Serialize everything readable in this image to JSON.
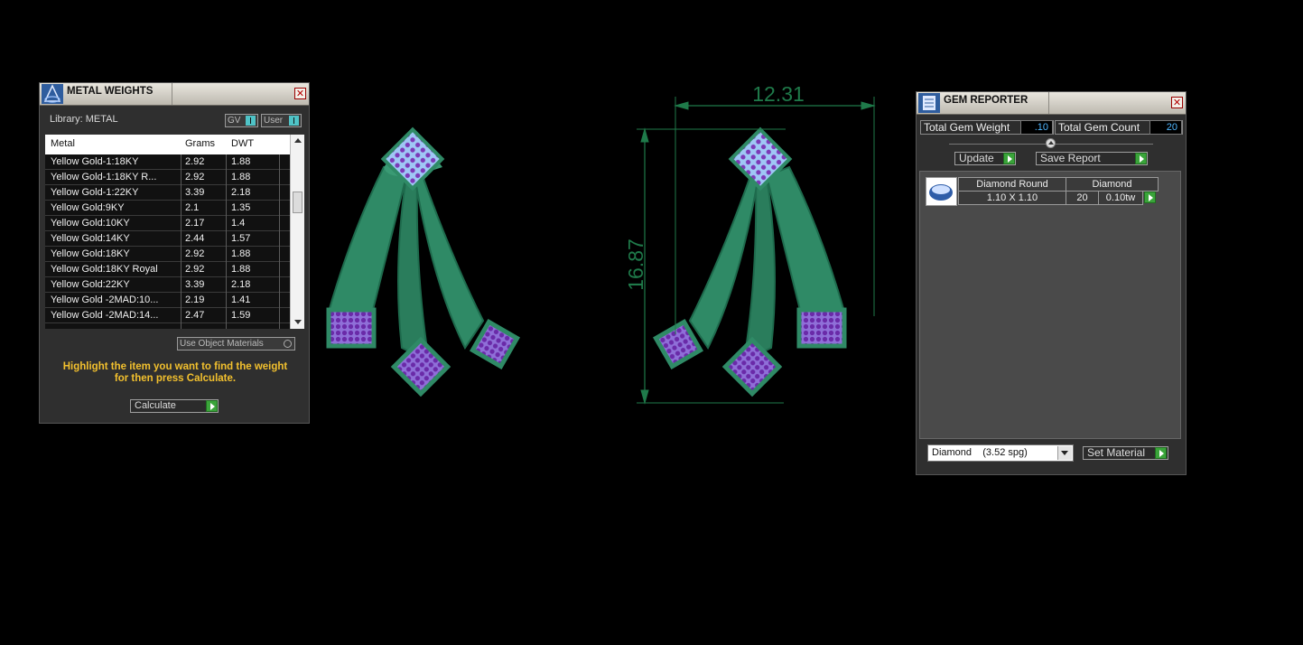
{
  "metal_weights": {
    "title": "METAL WEIGHTS",
    "library_label": "Library: METAL",
    "toggle_gv": "GV",
    "toggle_user": "User",
    "columns": [
      "Metal",
      "Grams",
      "DWT"
    ],
    "rows": [
      [
        "Yellow Gold-1:18KY",
        "2.92",
        "1.88"
      ],
      [
        "Yellow Gold-1:18KY R...",
        "2.92",
        "1.88"
      ],
      [
        "Yellow Gold-1:22KY",
        "3.39",
        "2.18"
      ],
      [
        "Yellow Gold:9KY",
        "2.1",
        "1.35"
      ],
      [
        "Yellow Gold:10KY",
        "2.17",
        "1.4"
      ],
      [
        "Yellow Gold:14KY",
        "2.44",
        "1.57"
      ],
      [
        "Yellow Gold:18KY",
        "2.92",
        "1.88"
      ],
      [
        "Yellow Gold:18KY Royal",
        "2.92",
        "1.88"
      ],
      [
        "Yellow Gold:22KY",
        "3.39",
        "2.18"
      ],
      [
        "Yellow Gold -2MAD:10...",
        "2.19",
        "1.41"
      ],
      [
        "Yellow Gold -2MAD:14...",
        "2.47",
        "1.59"
      ]
    ],
    "use_object_materials": "Use Object Materials",
    "hint_line1": "Highlight the item you want to find the weight",
    "hint_line2": "for then press Calculate.",
    "calculate_label": "Calculate"
  },
  "viewport": {
    "dimension_width": "12.31",
    "dimension_height": "16.87"
  },
  "gem_reporter": {
    "title": "GEM REPORTER",
    "total_weight_label": "Total Gem Weight",
    "total_weight_value": ".10",
    "total_count_label": "Total Gem Count",
    "total_count_value": "20",
    "update_label": "Update",
    "save_report_label": "Save Report",
    "gem_row": {
      "shape": "Diamond Round",
      "material": "Diamond",
      "size": "1.10 X 1.10",
      "count": "20",
      "weight": "0.10tw"
    },
    "material_select": "Diamond    (3.52 spg)",
    "set_material_label": "Set Material"
  },
  "colors": {
    "metal_green": "#2f8a66",
    "gem_blue": "#9fc7f5",
    "gem_purple": "#7c3ab8",
    "dimension_green": "#1f7a4a",
    "hint_yellow": "#f2c02e"
  }
}
